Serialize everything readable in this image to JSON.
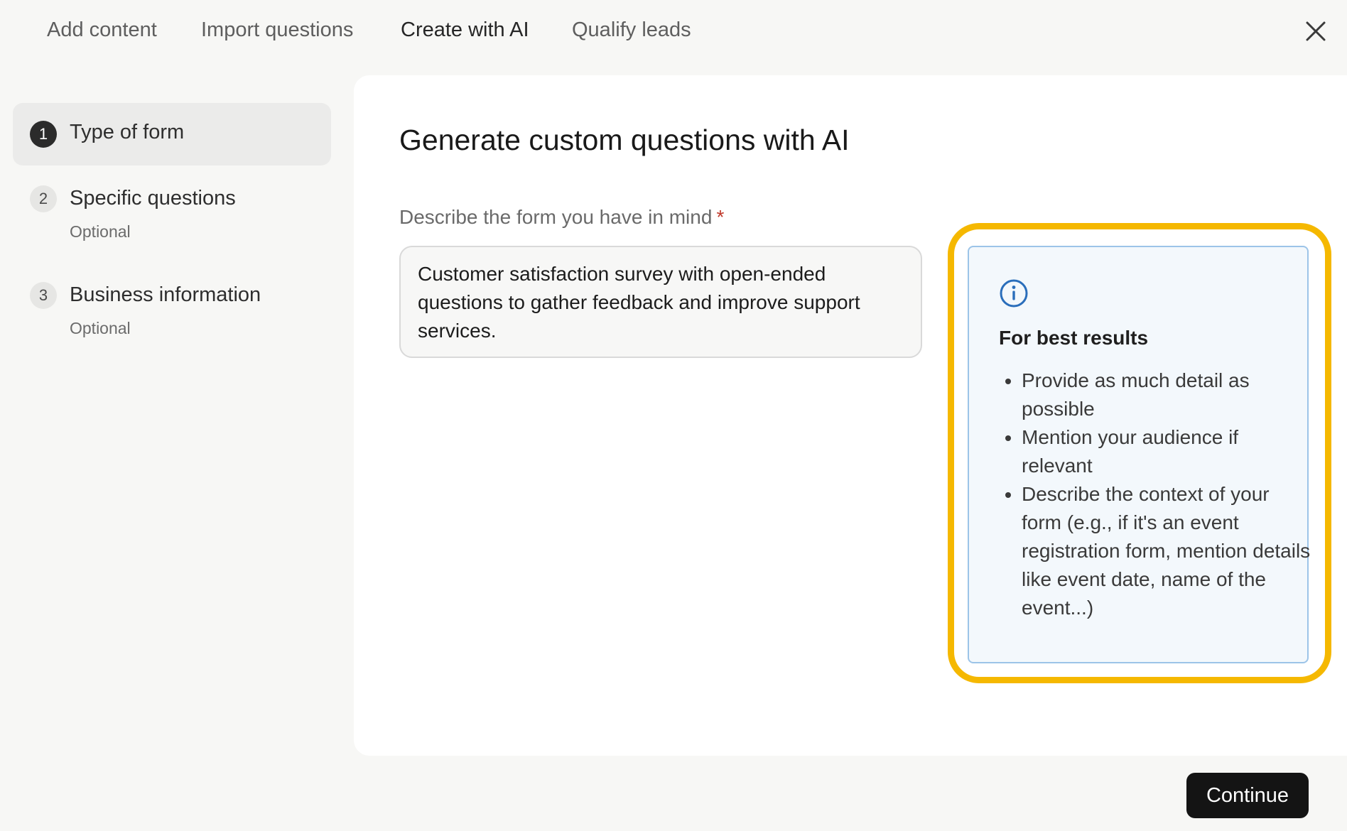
{
  "tabs": [
    {
      "label": "Add content",
      "active": false
    },
    {
      "label": "Import questions",
      "active": false
    },
    {
      "label": "Create with AI",
      "active": true
    },
    {
      "label": "Qualify leads",
      "active": false
    }
  ],
  "close_icon": "close-icon",
  "steps": [
    {
      "number": "1",
      "title": "Type of form",
      "subtitle": "",
      "active": true
    },
    {
      "number": "2",
      "title": "Specific questions",
      "subtitle": "Optional",
      "active": false
    },
    {
      "number": "3",
      "title": "Business information",
      "subtitle": "Optional",
      "active": false
    }
  ],
  "main": {
    "heading": "Generate custom questions with AI",
    "field_label": "Describe the form you have in mind",
    "required_marker": "*",
    "description_value": "Customer satisfaction survey with open-ended questions to gather feedback and improve support services."
  },
  "tips": {
    "icon": "info-icon",
    "title": "For best results",
    "items": [
      "Provide as much detail as possible",
      "Mention your audience if relevant",
      "Describe the context of your form (e.g., if it's an event registration form, mention details like event date, name of the event...)"
    ]
  },
  "footer": {
    "continue_label": "Continue"
  },
  "colors": {
    "highlight": "#f5b800",
    "info_blue": "#2a6ebb",
    "primary_button": "#141414"
  }
}
